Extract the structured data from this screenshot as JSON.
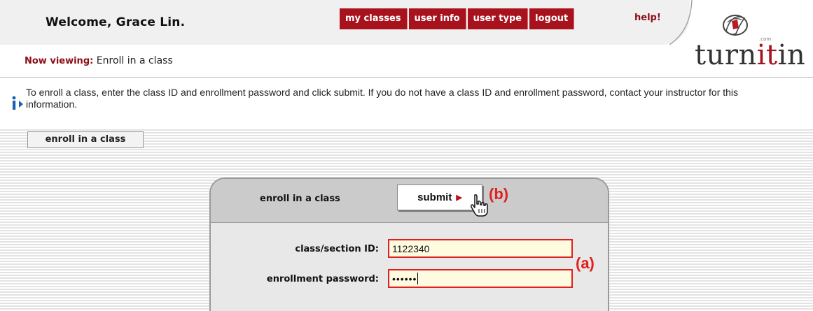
{
  "header": {
    "welcome": "Welcome, Grace Lin.",
    "nav": [
      "my classes",
      "user info",
      "user type",
      "logout"
    ],
    "help": "help!",
    "now_viewing_label": "Now viewing:",
    "now_viewing_value": "Enroll in a class"
  },
  "logo": {
    "prefix": "turn",
    "highlight": "it",
    "suffix": "in",
    "com": ".com"
  },
  "info": {
    "text": "To enroll a class, enter the class ID and enrollment password and click submit. If you do not have a class ID and enrollment password, contact your instructor for this information."
  },
  "tab": {
    "label": "enroll in a class"
  },
  "panel": {
    "title": "enroll in a class",
    "submit_label": "submit",
    "class_id_label": "class/section ID:",
    "class_id_value": "1122340",
    "password_label": "enrollment password:",
    "password_value": "••••••"
  },
  "annotations": {
    "a": "(a)",
    "b": "(b)"
  },
  "colors": {
    "brand_red": "#a8121c",
    "highlight_red": "#e0201f",
    "info_blue": "#1a5fb4"
  }
}
